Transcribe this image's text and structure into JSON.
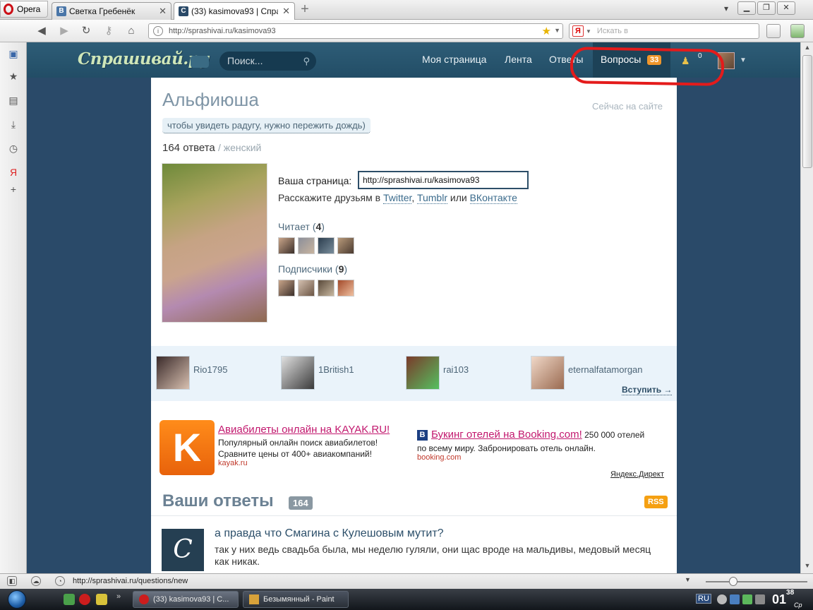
{
  "browser": {
    "menu_label": "Opera",
    "tabs": [
      {
        "label": "Светка Гребенёк",
        "favicon": "В"
      },
      {
        "label": "(33) kasimova93 | Спра…",
        "favicon": "С"
      }
    ],
    "url": "http://sprashivai.ru/kasimova93",
    "search_placeholder": "Искать в",
    "search_engine_icon": "Я",
    "status_url": "http://sprashivai.ru/questions/new"
  },
  "site": {
    "logo": "Спрашивай.ру",
    "search_placeholder": "Поиск...",
    "nav": {
      "my_page": "Моя страница",
      "feed": "Лента",
      "answers": "Ответы",
      "questions": "Вопросы",
      "questions_badge": "33",
      "coins": "0"
    }
  },
  "profile": {
    "name": "Альфиюша",
    "online": "Сейчас на сайте",
    "status": "чтобы увидеть радугу, нужно пережить дождь)",
    "answers_count": "164 ответа",
    "gender": "/ женский",
    "page_label": "Ваша страница:",
    "page_url": "http://sprashivai.ru/kasimova93",
    "share_prefix": "Расскажите друзьям в",
    "share_twitter": "Twitter",
    "share_sep": ",",
    "share_tumblr": "Tumblr",
    "share_or": "или",
    "share_vk": "ВКонтакте",
    "reads_label": "Читает",
    "reads_count": "4",
    "followers_label": "Подписчики",
    "followers_count": "9"
  },
  "suggestions": {
    "users": [
      "Rio1795",
      "1British1",
      "rai103",
      "eternalfatamorgan"
    ],
    "join": "Вступить →"
  },
  "ads": {
    "kayak": {
      "letter": "K",
      "title": "Авиабилеты онлайн на KAYAK.RU!",
      "line1": "Популярный онлайн поиск авиабилетов!",
      "line2": "Сравните цены от 400+ авиакомпаний!",
      "domain": "kayak.ru"
    },
    "booking": {
      "letter": "B",
      "title": "Букинг отелей на Booking.com!",
      "text_tail": "250 000 отелей",
      "line2": "по всему миру. Забронировать отель онлайн.",
      "domain": "booking.com"
    },
    "direct": "Яндекс.Директ"
  },
  "answers": {
    "title": "Ваши ответы",
    "count": "164",
    "rss": "RSS",
    "first": {
      "avatar_letter": "C",
      "question": "а правда что Смагина с Кулешовым мутит?",
      "text": "так у них ведь свадьба была, мы неделю гуляли, они щас вроде на мальдивы, медовый месяц как никак."
    }
  },
  "taskbar": {
    "tasks": [
      "(33) kasimova93 | С...",
      "Безымянный - Paint"
    ],
    "lang": "RU",
    "clock_hour": "01",
    "clock_min": "38",
    "clock_day": "Ср"
  },
  "colors": {
    "header": "#2e5d77",
    "badge": "#f0962b",
    "annotation": "#e41b1b",
    "ad_link": "#c2186e"
  }
}
